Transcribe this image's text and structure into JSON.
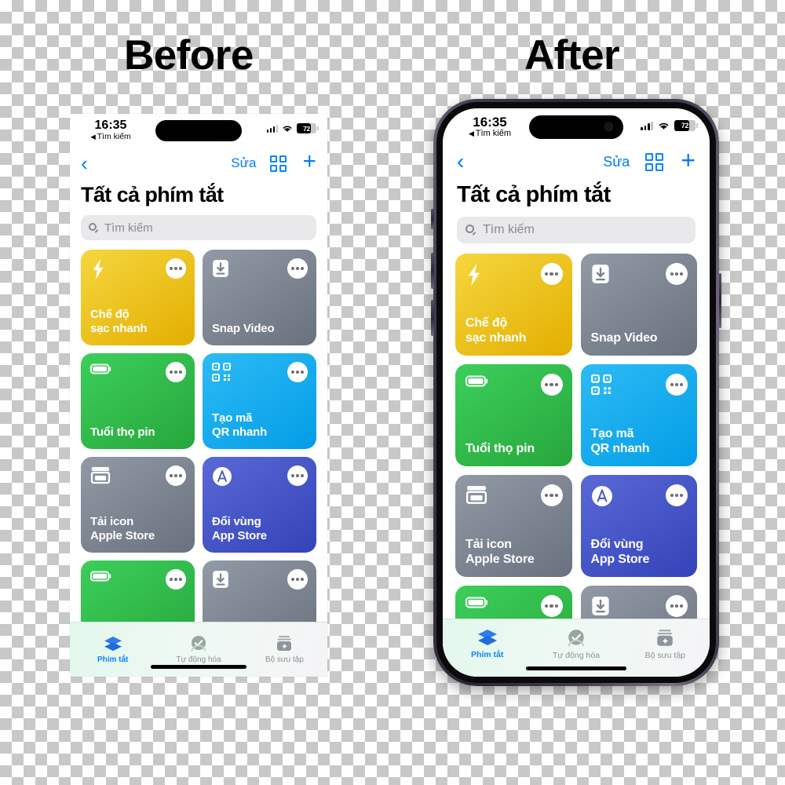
{
  "labels": {
    "before": "Before",
    "after": "After"
  },
  "colors": {
    "accent_blue": "#007aff",
    "card_yellow_a": "#f2cf2c",
    "card_yellow_b": "#e8b400",
    "card_gray_a": "#8b919d",
    "card_gray_b": "#6f7682",
    "card_green_a": "#36c851",
    "card_green_b": "#2aa93f",
    "card_cyan_a": "#26b4f0",
    "card_cyan_b": "#0aa4e8",
    "card_indigo_a": "#5160cf",
    "card_indigo_b": "#3f4fc2"
  },
  "status_bar": {
    "time": "16:35",
    "back_label": "Tìm kiếm",
    "back_arrow_icon": "triangle-left-icon",
    "cellular_icon": "cellular-bars-icon",
    "wifi_icon": "wifi-icon",
    "battery_icon": "battery-icon",
    "battery_percent": "72"
  },
  "nav_bar": {
    "back_icon": "chevron-left-icon",
    "edit_label": "Sửa",
    "grid_icon": "grid-view-icon",
    "add_icon": "plus-icon"
  },
  "page_title": "Tất cả phím tắt",
  "search": {
    "placeholder": "Tìm kiếm",
    "icon": "search-icon"
  },
  "shortcuts": [
    {
      "title": "Chế độ\nsạc nhanh",
      "line1": "Chế độ",
      "line2": "sạc nhanh",
      "icon": "bolt-icon",
      "color_a": "#f2cf2c",
      "color_b": "#e6b200",
      "menu_icon": "ellipsis-icon"
    },
    {
      "title": "Snap Video",
      "line1": "Snap Video",
      "line2": "",
      "icon": "download-box-icon",
      "color_a": "#8b919d",
      "color_b": "#6f7682",
      "menu_icon": "ellipsis-icon"
    },
    {
      "title": "Tuổi thọ pin",
      "line1": "Tuổi thọ pin",
      "line2": "",
      "icon": "battery-full-icon",
      "color_a": "#36c851",
      "color_b": "#2aa93f",
      "menu_icon": "ellipsis-icon"
    },
    {
      "title": "Tạo mã\nQR nhanh",
      "line1": "Tạo mã",
      "line2": "QR nhanh",
      "icon": "qr-code-icon",
      "color_a": "#26b4f0",
      "color_b": "#08a3e8",
      "menu_icon": "ellipsis-icon"
    },
    {
      "title": "Tải icon\nApple Store",
      "line1": "Tải icon",
      "line2": "Apple Store",
      "icon": "storefront-icon",
      "color_a": "#8b919d",
      "color_b": "#6f7682",
      "menu_icon": "ellipsis-icon"
    },
    {
      "title": "Đổi vùng\nApp Store",
      "line1": "Đổi vùng",
      "line2": "App Store",
      "icon": "app-store-icon",
      "color_a": "#5160cf",
      "color_b": "#3a4abf",
      "menu_icon": "ellipsis-icon"
    },
    {
      "title": "",
      "line1": "",
      "line2": "",
      "icon": "battery-full-icon",
      "color_a": "#36c851",
      "color_b": "#2aa93f",
      "menu_icon": "ellipsis-icon"
    },
    {
      "title": "",
      "line1": "",
      "line2": "",
      "icon": "download-box-icon",
      "color_a": "#8b919d",
      "color_b": "#6f7682",
      "menu_icon": "ellipsis-icon"
    }
  ],
  "tab_bar": [
    {
      "label": "Phím tắt",
      "icon": "shortcuts-layers-icon",
      "active": true
    },
    {
      "label": "Tự động hóa",
      "icon": "automation-check-icon",
      "active": false
    },
    {
      "label": "Bộ sưu tập",
      "icon": "gallery-sparkle-icon",
      "active": false
    }
  ]
}
